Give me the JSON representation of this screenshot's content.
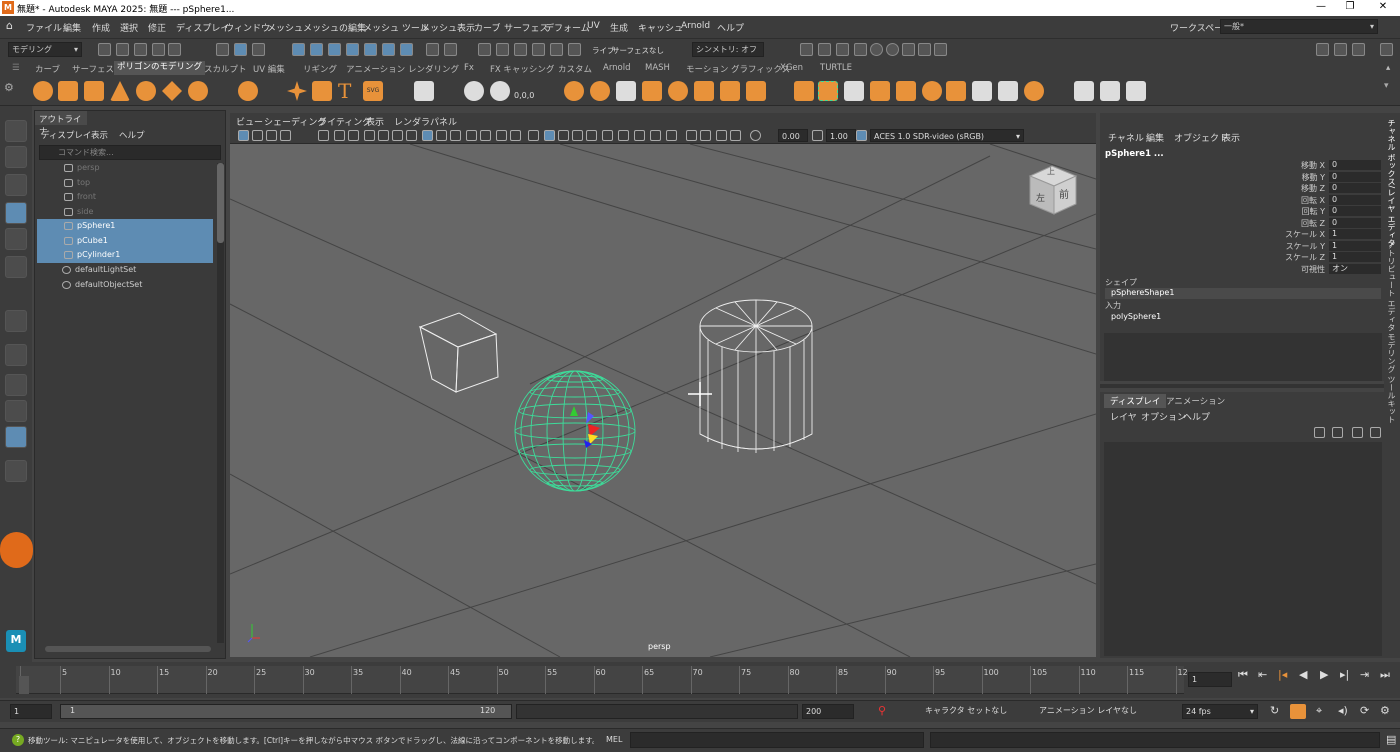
{
  "titlebar": {
    "title": "無題* - Autodesk MAYA 2025: 無題   ---   pSphere1...",
    "logo": "M"
  },
  "menubar": {
    "items": [
      "ファイル",
      "編集",
      "作成",
      "選択",
      "修正",
      "ディスプレイ",
      "ウィンドウ",
      "メッシュ",
      "メッシュの編集",
      "メッシュ ツール",
      "メッシュ表示",
      "カーブ",
      "サーフェス",
      "デフォーム",
      "UV",
      "生成",
      "キャッシュ",
      "Arnold",
      "ヘルプ"
    ],
    "workspace_label": "ワークスペース :",
    "workspace_value": "一般*"
  },
  "statusline": {
    "mode": "モデリング",
    "live": "ライブ",
    "surface": "サーフェスなし",
    "symmetry": "シンメトリ: オフ"
  },
  "shelf": {
    "tabs": [
      "カーブ",
      "サーフェス",
      "ポリゴンのモデリング",
      "スカルプト",
      "UV 編集",
      "リギング",
      "アニメーション",
      "レンダリング",
      "Fx",
      "FX キャッシング",
      "カスタム",
      "Arnold",
      "MASH",
      "モーション グラフィックス",
      "XGen",
      "TURTLE"
    ],
    "active_tab": "ポリゴンのモデリング",
    "coord_label": "0,0,0"
  },
  "outliner": {
    "tab": "アウトライナ",
    "menu": [
      "ディスプレイ",
      "表示",
      "ヘルプ"
    ],
    "search_placeholder": "コマンド検索...",
    "rows": [
      {
        "label": "persp",
        "dim": true
      },
      {
        "label": "top",
        "dim": true
      },
      {
        "label": "front",
        "dim": true
      },
      {
        "label": "side",
        "dim": true
      },
      {
        "label": "pSphere1",
        "selected": true
      },
      {
        "label": "pCube1",
        "selected": true
      },
      {
        "label": "pCylinder1",
        "selected": true
      },
      {
        "label": "defaultLightSet",
        "set": true
      },
      {
        "label": "defaultObjectSet",
        "set": true
      }
    ]
  },
  "viewport": {
    "menu": [
      "ビュー",
      "シェーディング",
      "ライティング",
      "表示",
      "レンダラ",
      "パネル"
    ],
    "exposure": "0.00",
    "gamma": "1.00",
    "colorspace": "ACES 1.0 SDR-video (sRGB)",
    "camera_label": "persp",
    "viewcube_top": "上",
    "viewcube_front": "前",
    "viewcube_left": "左"
  },
  "channelbox": {
    "menu": [
      "チャネル",
      "編集",
      "オブジェクト",
      "表示"
    ],
    "object": "pSphere1 ...",
    "attrs": [
      {
        "label": "移動 X",
        "value": "0"
      },
      {
        "label": "移動 Y",
        "value": "0"
      },
      {
        "label": "移動 Z",
        "value": "0"
      },
      {
        "label": "回転 X",
        "value": "0"
      },
      {
        "label": "回転 Y",
        "value": "0"
      },
      {
        "label": "回転 Z",
        "value": "0"
      },
      {
        "label": "スケール X",
        "value": "1"
      },
      {
        "label": "スケール Y",
        "value": "1"
      },
      {
        "label": "スケール Z",
        "value": "1"
      },
      {
        "label": "可視性",
        "value": "オン"
      }
    ],
    "shape_label": "シェイプ",
    "shape": "pSphereShape1",
    "input_label": "入力",
    "input": "polySphere1"
  },
  "layers": {
    "tabs": [
      "ディスプレイ",
      "アニメーション"
    ],
    "menu": [
      "レイヤ",
      "オプション",
      "ヘルプ"
    ]
  },
  "sidestrip": {
    "labels": [
      "チャネル ボックス/レイヤ エディタ",
      "アトリビュート エディタ",
      "モデリング ツールキット"
    ]
  },
  "timeline": {
    "ticks": [
      "1",
      "5",
      "10",
      "15",
      "20",
      "25",
      "30",
      "35",
      "40",
      "45",
      "50",
      "55",
      "60",
      "65",
      "70",
      "75",
      "80",
      "85",
      "90",
      "95",
      "100",
      "105",
      "110",
      "115",
      "12"
    ],
    "current_frame": "1"
  },
  "range": {
    "start": "1",
    "inner_start": "1",
    "inner_end": "120",
    "end": "200",
    "character_set": "キャラクタ セットなし",
    "anim_layer": "アニメーション レイヤなし",
    "fps": "24 fps"
  },
  "cmdline": {
    "help": "移動ツール: マニピュレータを使用して、オブジェクトを移動します。[Ctrl]キーを押しながら中マウス ボタンでドラッグし、法線に沿ってコンポーネントを移動します。[Shift]キーを押しながらマニピ",
    "mel": "MEL"
  },
  "colors": {
    "accent": "#e8923a",
    "selection": "#5e8cb3",
    "wire_selected": "#3ddc9a"
  }
}
